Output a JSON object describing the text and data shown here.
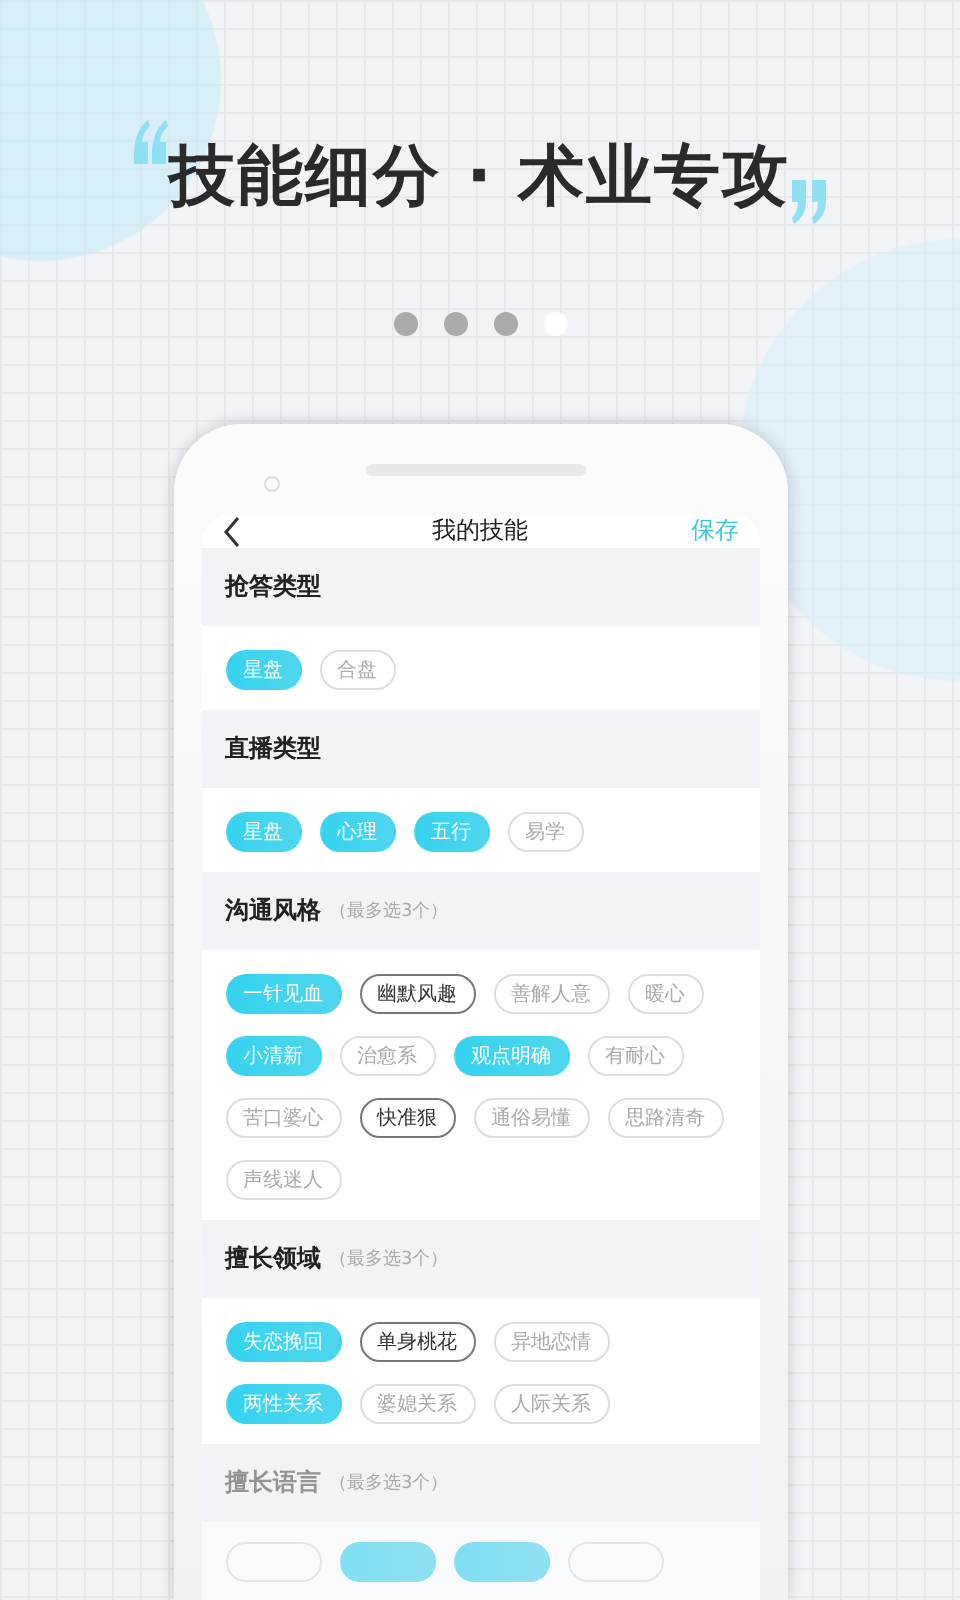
{
  "headline": "技能细分 · 术业专攻",
  "carousel_dots": [
    {
      "selected": false
    },
    {
      "selected": false
    },
    {
      "selected": false
    },
    {
      "selected": true
    }
  ],
  "app": {
    "nav": {
      "title": "我的技能",
      "action": "保存"
    },
    "sections": [
      {
        "title": "抢答类型",
        "tags": [
          {
            "label": "星盘",
            "selected": true,
            "highlighted": false
          },
          {
            "label": "合盘",
            "selected": false,
            "highlighted": false
          }
        ]
      },
      {
        "title": "直播类型",
        "tags": [
          {
            "label": "星盘",
            "selected": true,
            "highlighted": false
          },
          {
            "label": "心理",
            "selected": true,
            "highlighted": false
          },
          {
            "label": "五行",
            "selected": true,
            "highlighted": false
          },
          {
            "label": "易学",
            "selected": false,
            "highlighted": false
          }
        ]
      },
      {
        "title": "沟通风格",
        "note": "（最多选3个）",
        "tags": [
          {
            "label": "一针见血",
            "selected": true,
            "highlighted": false
          },
          {
            "label": "幽默风趣",
            "selected": false,
            "highlighted": true
          },
          {
            "label": "善解人意",
            "selected": false,
            "highlighted": false
          },
          {
            "label": "暖心",
            "selected": false,
            "highlighted": false
          },
          {
            "label": "小清新",
            "selected": true,
            "highlighted": false
          },
          {
            "label": "治愈系",
            "selected": false,
            "highlighted": false
          },
          {
            "label": "观点明确",
            "selected": true,
            "highlighted": false
          },
          {
            "label": "有耐心",
            "selected": false,
            "highlighted": false
          },
          {
            "label": "苦口婆心",
            "selected": false,
            "highlighted": false
          },
          {
            "label": "快准狠",
            "selected": false,
            "highlighted": true
          },
          {
            "label": "通俗易懂",
            "selected": false,
            "highlighted": false
          },
          {
            "label": "思路清奇",
            "selected": false,
            "highlighted": false
          },
          {
            "label": "声线迷人",
            "selected": false,
            "highlighted": false
          }
        ]
      },
      {
        "title": "擅长领域",
        "note": "（最多选3个）",
        "tags": [
          {
            "label": "失恋挽回",
            "selected": true,
            "highlighted": false
          },
          {
            "label": "单身桃花",
            "selected": false,
            "highlighted": true
          },
          {
            "label": "异地恋情",
            "selected": false,
            "highlighted": false
          },
          {
            "label": "两性关系",
            "selected": true,
            "highlighted": false
          },
          {
            "label": "婆媳关系",
            "selected": false,
            "highlighted": false
          },
          {
            "label": "人际关系",
            "selected": false,
            "highlighted": false
          }
        ]
      },
      {
        "title": "擅长语言",
        "note": "（最多选3个）",
        "tags": [
          {
            "selected": false,
            "highlighted": false
          },
          {
            "selected": true,
            "highlighted": false
          },
          {
            "selected": true,
            "highlighted": false
          },
          {
            "selected": false,
            "highlighted": false
          }
        ]
      }
    ]
  }
}
